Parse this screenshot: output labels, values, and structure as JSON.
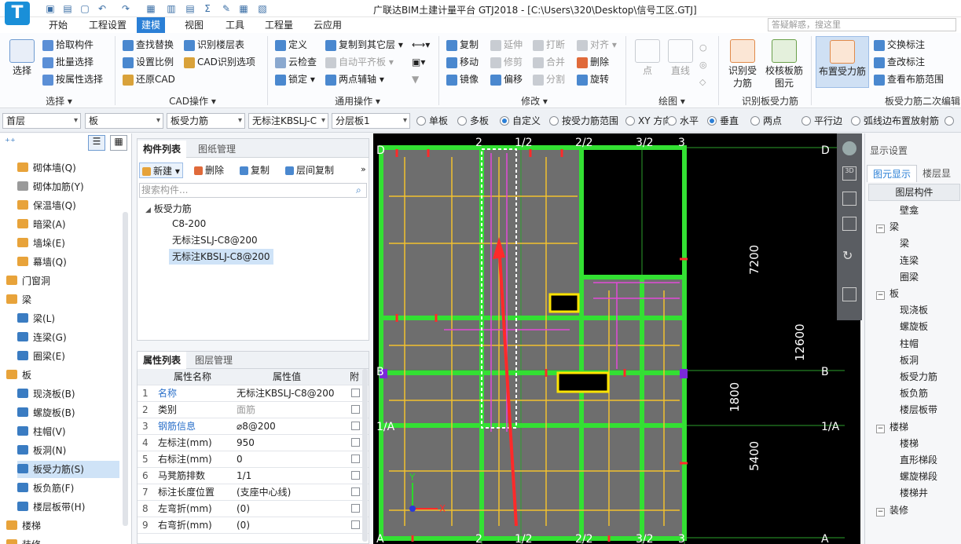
{
  "window": {
    "logo": "T",
    "title": "广联达BIM土建计量平台 GTJ2018 - [C:\\Users\\320\\Desktop\\信号工区.GTJ]"
  },
  "menu": {
    "tabs": [
      "开始",
      "工程设置",
      "建模",
      "视图",
      "工具",
      "工程量",
      "云应用"
    ],
    "active": "建模",
    "search_placeholder": "答疑解惑，搜这里"
  },
  "ribbon": {
    "select": {
      "big": "选择",
      "group": "选择"
    },
    "select_items": [
      "拾取构件",
      "批量选择",
      "按属性选择"
    ],
    "cad_items": [
      "查找替换",
      "识别楼层表",
      "设置比例",
      "CAD识别选项",
      "还原CAD"
    ],
    "cad_group": "CAD操作",
    "common_items": [
      "定义",
      "复制到其它层",
      "云检查",
      "自动平齐板",
      "锁定",
      "两点辅轴"
    ],
    "common_group": "通用操作",
    "modify_items": [
      "复制",
      "延伸",
      "打断",
      "对齐",
      "移动",
      "修剪",
      "合并",
      "删除",
      "镜像",
      "偏移",
      "分割",
      "旋转"
    ],
    "modify_group": "修改",
    "draw_items": [
      "点",
      "直线"
    ],
    "draw_group": "绘图",
    "identify_items": [
      "识别受力筋",
      "校核板筋图元"
    ],
    "identify_group": "识别板受力筋",
    "layout_big": "布置受力筋",
    "second_items": [
      "交换标注",
      "查改标注",
      "查看布筋范围"
    ],
    "second_group": "板受力筋二次编辑"
  },
  "toolbar2": {
    "floor": "首层",
    "category": "板",
    "type": "板受力筋",
    "component": "无标注KBSLJ-C",
    "layer": "分层板1",
    "radios": [
      "单板",
      "多板",
      "自定义",
      "按受力筋范围",
      "XY 方向",
      "水平",
      "垂直",
      "两点",
      "平行边",
      "弧线边布置放射筋"
    ],
    "checked": [
      "自定义",
      "垂直"
    ]
  },
  "left_tree": {
    "items": [
      {
        "label": "砌体墙(Q)",
        "level": 2,
        "color": "#e8a33a"
      },
      {
        "label": "砌体加筋(Y)",
        "level": 2,
        "color": "#9a9a9a"
      },
      {
        "label": "保温墙(Q)",
        "level": 2,
        "color": "#e8a33a"
      },
      {
        "label": "暗梁(A)",
        "level": 2,
        "color": "#e8a33a"
      },
      {
        "label": "墙垛(E)",
        "level": 2,
        "color": "#e8a33a"
      },
      {
        "label": "幕墙(Q)",
        "level": 2,
        "color": "#e8a33a"
      },
      {
        "label": "门窗洞",
        "level": 1,
        "color": "#e8a33a"
      },
      {
        "label": "梁",
        "level": 1,
        "color": "#e8a33a"
      },
      {
        "label": "梁(L)",
        "level": 2,
        "color": "#3a7cc2"
      },
      {
        "label": "连梁(G)",
        "level": 2,
        "color": "#3a7cc2"
      },
      {
        "label": "圈梁(E)",
        "level": 2,
        "color": "#3a7cc2"
      },
      {
        "label": "板",
        "level": 1,
        "color": "#e8a33a"
      },
      {
        "label": "现浇板(B)",
        "level": 2,
        "color": "#3a7cc2"
      },
      {
        "label": "螺旋板(B)",
        "level": 2,
        "color": "#3a7cc2"
      },
      {
        "label": "柱帽(V)",
        "level": 2,
        "color": "#3a7cc2"
      },
      {
        "label": "板洞(N)",
        "level": 2,
        "color": "#3a7cc2"
      },
      {
        "label": "板受力筋(S)",
        "level": 2,
        "color": "#3a7cc2",
        "selected": true
      },
      {
        "label": "板负筋(F)",
        "level": 2,
        "color": "#3a7cc2"
      },
      {
        "label": "楼层板带(H)",
        "level": 2,
        "color": "#3a7cc2"
      },
      {
        "label": "楼梯",
        "level": 1,
        "color": "#e8a33a"
      },
      {
        "label": "装修",
        "level": 1,
        "color": "#e8a33a"
      }
    ]
  },
  "component_panel": {
    "tabs": [
      "构件列表",
      "图纸管理"
    ],
    "buttons": [
      "新建",
      "删除",
      "复制",
      "层间复制"
    ],
    "search_placeholder": "搜索构件...",
    "root": "板受力筋",
    "items": [
      "C8-200",
      "无标注SLJ-C8@200",
      "无标注KBSLJ-C8@200"
    ],
    "selected": "无标注KBSLJ-C8@200"
  },
  "property_panel": {
    "tabs": [
      "属性列表",
      "图层管理"
    ],
    "headers": [
      "属性名称",
      "属性值",
      "附"
    ],
    "rows": [
      {
        "n": "1",
        "name": "名称",
        "value": "无标注KBSLJ-C8@200",
        "link": true
      },
      {
        "n": "2",
        "name": "类别",
        "value": "面筋",
        "gray": true
      },
      {
        "n": "3",
        "name": "钢筋信息",
        "value": "⌀8@200",
        "link": true
      },
      {
        "n": "4",
        "name": "左标注(mm)",
        "value": "950"
      },
      {
        "n": "5",
        "name": "右标注(mm)",
        "value": "0"
      },
      {
        "n": "6",
        "name": "马凳筋排数",
        "value": "1/1"
      },
      {
        "n": "7",
        "name": "标注长度位置",
        "value": "(支座中心线)"
      },
      {
        "n": "8",
        "name": "左弯折(mm)",
        "value": "(0)"
      },
      {
        "n": "9",
        "name": "右弯折(mm)",
        "value": "(0)"
      }
    ]
  },
  "canvas": {
    "axis_top": [
      "2",
      "1/2",
      "2/2",
      "3/2",
      "3"
    ],
    "axis_right": [
      "D",
      "B",
      "1/A",
      "A"
    ],
    "axis_left": [
      "D",
      "B",
      "1/A",
      "A"
    ],
    "axis_bottom": [
      "2",
      "1/2",
      "2/2",
      "3/2",
      "3"
    ],
    "dims": [
      "7200",
      "12600",
      "1800",
      "5400"
    ],
    "ucs": [
      "Y",
      "X"
    ]
  },
  "right_panel": {
    "header": "显示设置",
    "tabs": [
      "图元显示",
      "楼层显示"
    ],
    "col_header": "图层构件",
    "items": [
      {
        "label": "壁龛",
        "level": 2
      },
      {
        "label": "梁",
        "level": 1
      },
      {
        "label": "梁",
        "level": 2
      },
      {
        "label": "连梁",
        "level": 2
      },
      {
        "label": "圈梁",
        "level": 2
      },
      {
        "label": "板",
        "level": 1
      },
      {
        "label": "现浇板",
        "level": 2
      },
      {
        "label": "螺旋板",
        "level": 2
      },
      {
        "label": "柱帽",
        "level": 2
      },
      {
        "label": "板洞",
        "level": 2
      },
      {
        "label": "板受力筋",
        "level": 2
      },
      {
        "label": "板负筋",
        "level": 2
      },
      {
        "label": "楼层板带",
        "level": 2
      },
      {
        "label": "楼梯",
        "level": 1
      },
      {
        "label": "楼梯",
        "level": 2
      },
      {
        "label": "直形梯段",
        "level": 2
      },
      {
        "label": "螺旋梯段",
        "level": 2
      },
      {
        "label": "楼梯井",
        "level": 2
      },
      {
        "label": "装修",
        "level": 1
      }
    ]
  }
}
